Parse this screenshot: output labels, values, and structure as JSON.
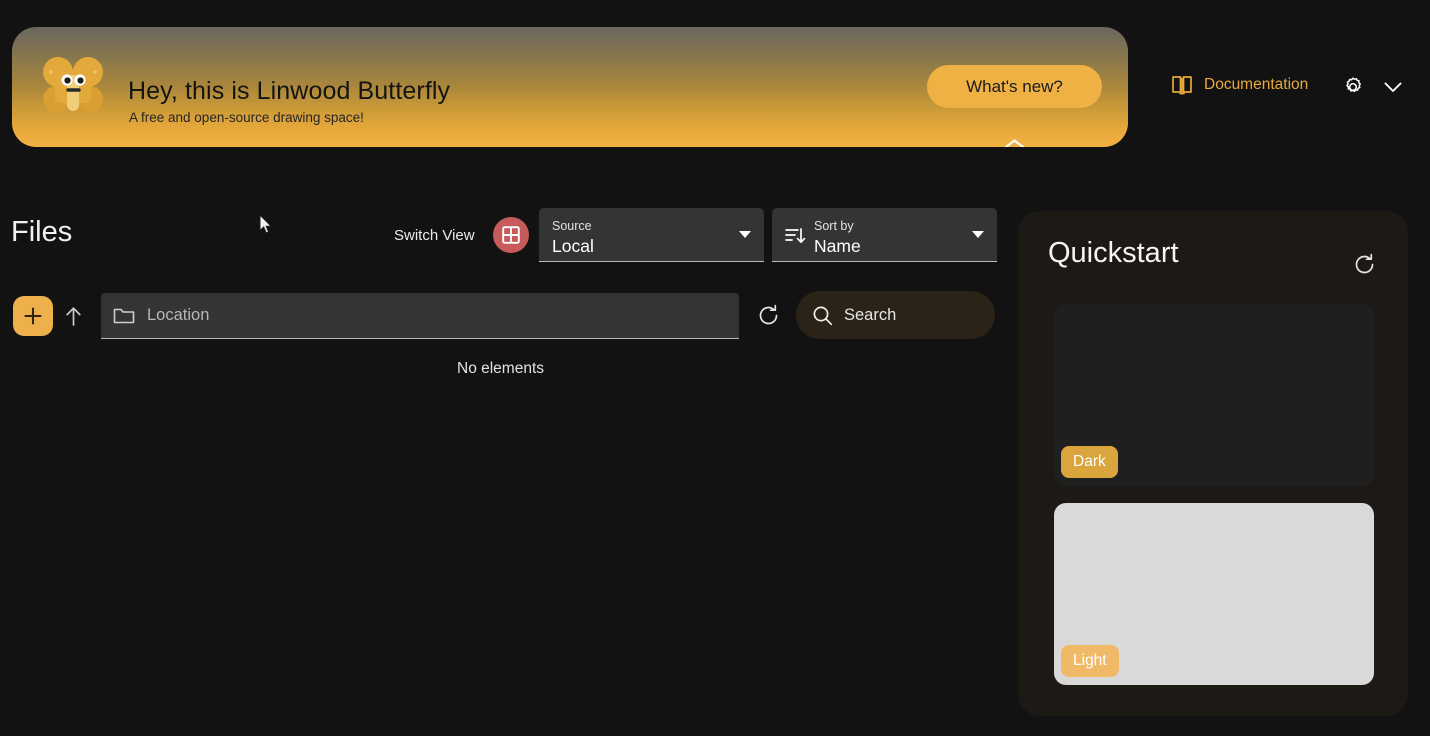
{
  "banner": {
    "logo_icon": "butterfly-logo",
    "title": "Hey, this is Linwood Butterfly",
    "subtitle": "A free and open-source drawing space!",
    "whats_new_label": "What's new?",
    "collapse_icon": "chevron-up-icon",
    "gradient_top": "#6a665e",
    "gradient_bottom": "#f2b143",
    "accent": "#efb144"
  },
  "topbar": {
    "documentation_label": "Documentation",
    "documentation_icon": "book-icon",
    "settings_icon": "gear-icon",
    "more_icon": "chevron-down-icon",
    "accent": "#e8a93a"
  },
  "files": {
    "title": "Files",
    "switch_view_label": "Switch View",
    "switch_view_icon": "grid-view-icon",
    "switch_view_color": "#c75b5b",
    "source": {
      "label": "Source",
      "value": "Local"
    },
    "sort": {
      "label": "Sort by",
      "value": "Name",
      "icon": "sort-descending-icon"
    },
    "add_icon": "plus-icon",
    "add_color": "#eeb04a",
    "up_icon": "arrow-up-icon",
    "location": {
      "icon": "folder-icon",
      "value": "",
      "placeholder": "Location"
    },
    "refresh_icon": "refresh-icon",
    "search": {
      "icon": "search-icon",
      "value": "",
      "placeholder": "Search"
    },
    "empty_message": "No elements"
  },
  "quickstart": {
    "title": "Quickstart",
    "refresh_icon": "refresh-icon",
    "cards": [
      {
        "label": "Dark",
        "badge_color": "#d9a53c",
        "surface": "#1f1f1f"
      },
      {
        "label": "Light",
        "badge_color": "#efb968",
        "surface": "#d9d9d9"
      }
    ]
  },
  "cursor": {
    "icon": "mouse-pointer-icon"
  }
}
